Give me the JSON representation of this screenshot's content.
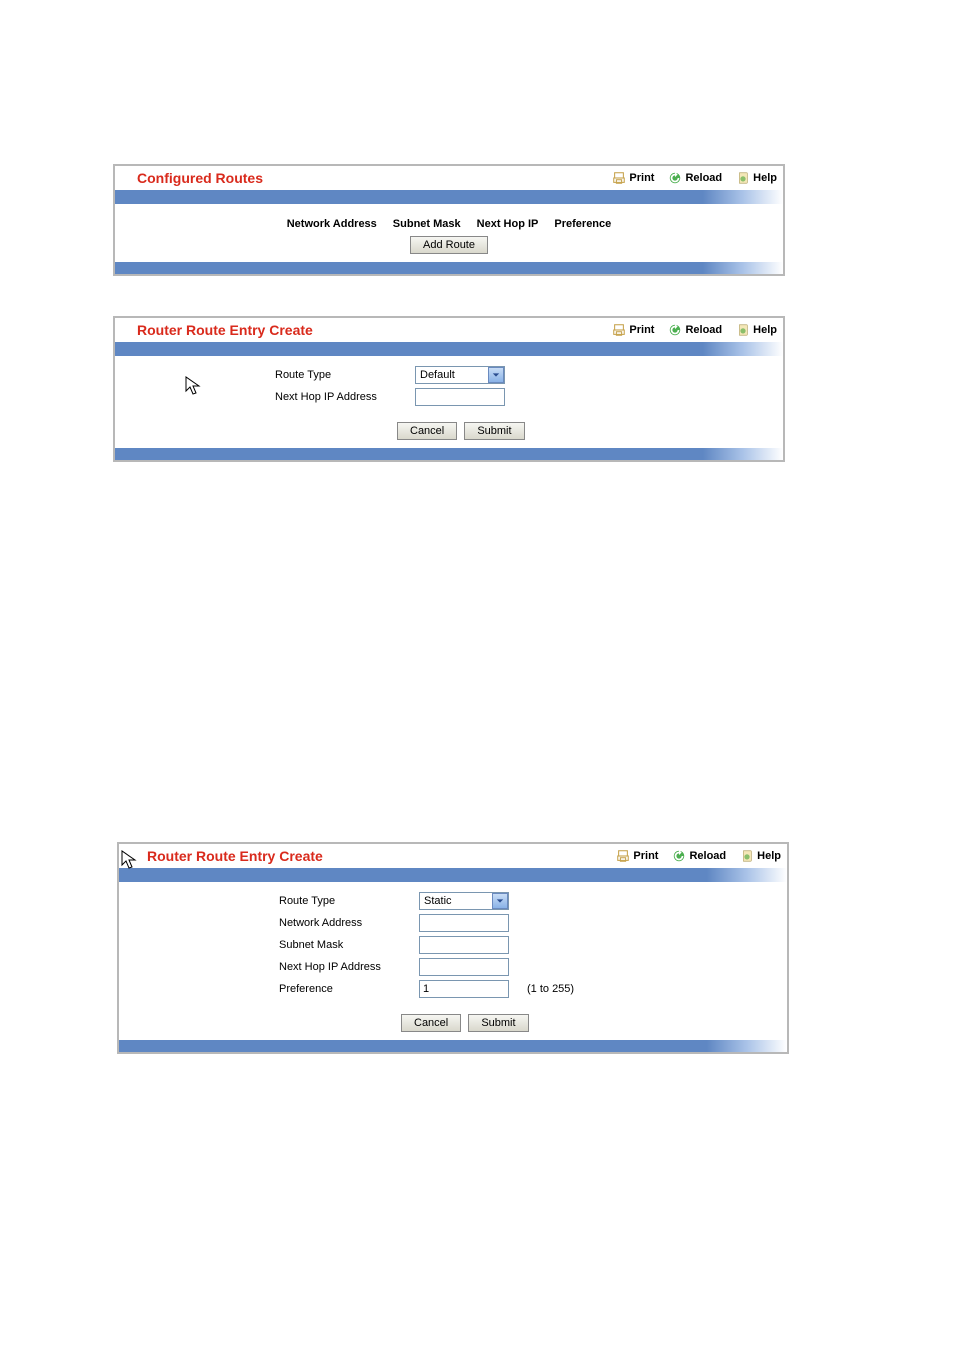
{
  "toolbar": {
    "print": "Print",
    "reload": "Reload",
    "help": "Help"
  },
  "panel1": {
    "title": "Configured Routes",
    "headers": {
      "network_address": "Network Address",
      "subnet_mask": "Subnet Mask",
      "next_hop_ip": "Next Hop IP",
      "preference": "Preference"
    },
    "add_route_btn": "Add Route"
  },
  "panel2": {
    "title": "Router Route Entry Create",
    "labels": {
      "route_type": "Route Type",
      "next_hop_ip": "Next Hop IP Address"
    },
    "route_type_value": "Default",
    "next_hop_value": "",
    "cancel_btn": "Cancel",
    "submit_btn": "Submit"
  },
  "panel3": {
    "title": "Router Route Entry Create",
    "labels": {
      "route_type": "Route Type",
      "network_address": "Network Address",
      "subnet_mask": "Subnet Mask",
      "next_hop_ip": "Next Hop IP Address",
      "preference": "Preference"
    },
    "route_type_value": "Static",
    "network_address_value": "",
    "subnet_mask_value": "",
    "next_hop_value": "",
    "preference_value": "1",
    "preference_hint": "(1 to 255)",
    "cancel_btn": "Cancel",
    "submit_btn": "Submit"
  }
}
